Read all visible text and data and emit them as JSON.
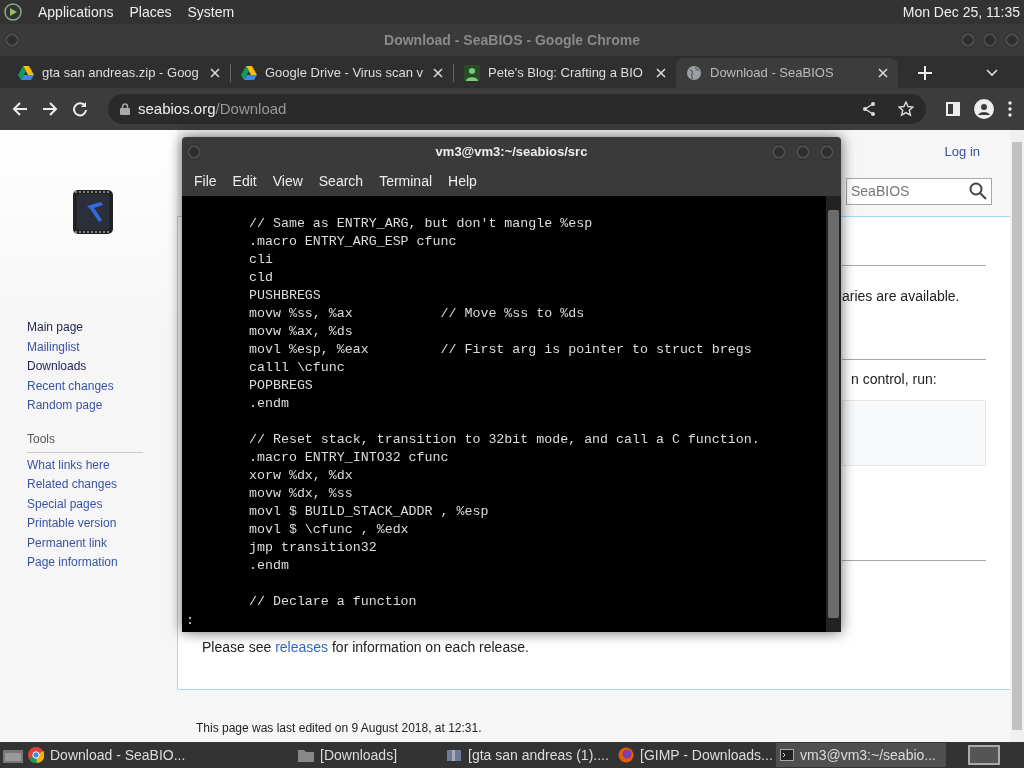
{
  "top_panel": {
    "menus": [
      "Applications",
      "Places",
      "System"
    ],
    "clock": "Mon Dec 25, 11:35"
  },
  "browser": {
    "title": "Download - SeaBIOS - Google Chrome",
    "tabs": [
      {
        "label": "gta san andreas.zip - Goog",
        "kind": "drive",
        "selected": false
      },
      {
        "label": "Google Drive - Virus scan v",
        "kind": "drive",
        "selected": false
      },
      {
        "label": "Pete's Blog: Crafting a BIO",
        "kind": "blog",
        "selected": false
      },
      {
        "label": "Download - SeaBIOS",
        "kind": "globe",
        "selected": true
      }
    ],
    "url": {
      "host": "seabios.org",
      "path": "/Download"
    }
  },
  "wiki": {
    "login": "Log in",
    "search": {
      "placeholder": "SeaBIOS"
    },
    "nav": [
      {
        "label": "Main page",
        "visited": true
      },
      {
        "label": "Mailinglist",
        "visited": false
      },
      {
        "label": "Downloads",
        "visited": true
      },
      {
        "label": "Recent changes",
        "visited": false
      },
      {
        "label": "Random page",
        "visited": false
      }
    ],
    "tools_heading": "Tools",
    "tools": [
      {
        "label": "What links here",
        "visited": false
      },
      {
        "label": "Related changes",
        "visited": false
      },
      {
        "label": "Special pages",
        "visited": false
      },
      {
        "label": "Printable version",
        "visited": false
      },
      {
        "label": "Permanent link",
        "visited": false
      },
      {
        "label": "Page information",
        "visited": false
      }
    ],
    "fragment_1": "aries are available.",
    "fragment_2": "n control, run:",
    "release_note": {
      "before": "Please see ",
      "link": "releases",
      "after": " for information on each release."
    },
    "footer": "This page was last edited on 9 August 2018, at 12:31."
  },
  "terminal": {
    "title": "vm3@vm3:~/seabios/src",
    "menus": [
      "File",
      "Edit",
      "View",
      "Search",
      "Terminal",
      "Help"
    ],
    "code_blocks": [
      [
        "// Same as ENTRY_ARG, but don't mangle %esp",
        ".macro ENTRY_ARG_ESP cfunc",
        "cli",
        "cld",
        "PUSHBREGS",
        "movw %ss, %ax           // Move %ss to %ds",
        "movw %ax, %ds",
        "movl %esp, %eax         // First arg is pointer to struct bregs",
        "calll \\cfunc",
        "POPBREGS",
        ".endm"
      ],
      [
        "// Reset stack, transition to 32bit mode, and call a C function.",
        ".macro ENTRY_INTO32 cfunc",
        "xorw %dx, %dx",
        "movw %dx, %ss",
        "movl $ BUILD_STACK_ADDR , %esp",
        "movl $ \\cfunc , %edx",
        "jmp transition32",
        ".endm"
      ],
      [
        "// Declare a function"
      ]
    ],
    "prompt": ":"
  },
  "taskbar": [
    {
      "label": "Download - SeaBIO...",
      "kind": "chrome",
      "selected": false
    },
    {
      "label": "[Downloads]",
      "kind": "folder",
      "selected": false
    },
    {
      "label": "[gta san andreas (1)....",
      "kind": "archive",
      "selected": false
    },
    {
      "label": "[GIMP - Downloads...",
      "kind": "gimp",
      "selected": false
    },
    {
      "label": "vm3@vm3:~/seabio...",
      "kind": "terminal",
      "selected": true
    }
  ]
}
